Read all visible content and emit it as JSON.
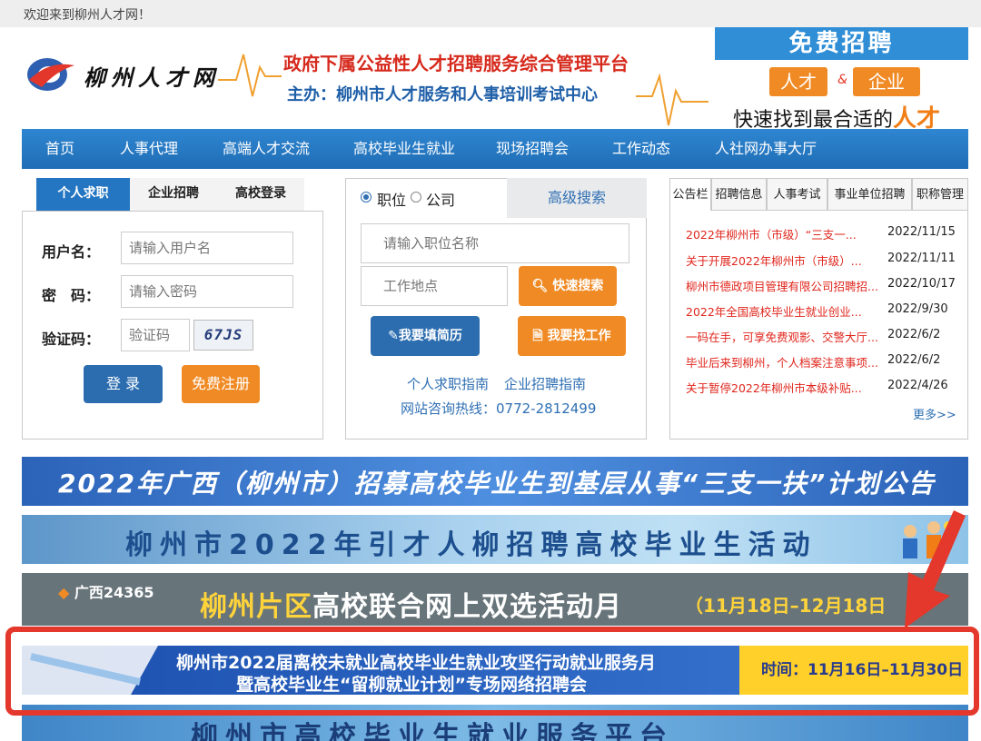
{
  "topbar": {
    "welcome": "欢迎来到柳州人才网！"
  },
  "header": {
    "logo_text": "柳州人才网",
    "slogan_line1": "政府下属公益性人才招聘服务综合管理平台",
    "slogan_line2": "主办：柳州市人才服务和人事培训考试中心",
    "ad_title": "免费招聘",
    "ad_tag1": "人才",
    "ad_amp": "&",
    "ad_tag2": "企业",
    "ad_line": "快速找到最合适的",
    "ad_line_highlight": "人才"
  },
  "nav": {
    "items": [
      "首页",
      "人事代理",
      "高端人才交流",
      "高校毕业生就业",
      "现场招聘会",
      "工作动态",
      "人社网办事大厅"
    ]
  },
  "login": {
    "tabs": [
      "个人求职",
      "企业招聘",
      "高校登录"
    ],
    "username_label": "用户名：",
    "username_placeholder": "请输入用户名",
    "password_label": "密　码：",
    "password_placeholder": "请输入密码",
    "captcha_label": "验证码：",
    "captcha_placeholder": "验证码",
    "captcha_image_text": "67JS",
    "login_button": "登 录",
    "register_button": "免费注册"
  },
  "search": {
    "radio_job": "职位",
    "radio_company": "公司",
    "advanced_tab": "高级搜索",
    "job_placeholder": "请输入职位名称",
    "location_placeholder": "工作地点",
    "quick_search_button": "快速搜索",
    "fill_resume_button": "我要填简历",
    "find_job_button": "我要找工作",
    "guide_personal": "个人求职指南",
    "guide_company": "企业招聘指南",
    "hotline": "网站咨询热线：0772-2812499"
  },
  "notices": {
    "tabs": [
      "公告栏",
      "招聘信息",
      "人事考试",
      "事业单位招聘",
      "职称管理"
    ],
    "items": [
      {
        "title": "2022年柳州市（市级）“三支一...",
        "date": "2022/11/15"
      },
      {
        "title": "关于开展2022年柳州市（市级）...",
        "date": "2022/11/11"
      },
      {
        "title": "柳州市德政项目管理有限公司招聘招...",
        "date": "2022/10/17"
      },
      {
        "title": "2022年全国高校毕业生就业创业...",
        "date": "2022/9/30"
      },
      {
        "title": "一码在手，可享免费观影、交警大厅...",
        "date": "2022/6/2"
      },
      {
        "title": "毕业后来到柳州，个人档案注意事项...",
        "date": "2022/6/2"
      },
      {
        "title": "关于暂停2022年柳州市本级补贴...",
        "date": "2022/4/26"
      }
    ],
    "more": "更多>>"
  },
  "banners": {
    "b1": "2022年广西（柳州市）招募高校毕业生到基层从事“三支一扶”计划公告",
    "b2": "柳州市2022年引才人柳招聘高校毕业生活动",
    "b3_logo": "广西24365",
    "b3_main_prefix": "柳州片区",
    "b3_main_rest": "高校联合网上双选活动月",
    "b3_date": "（11月18日–12月18日",
    "b4_line1": "柳州市2022届离校未就业高校毕业生就业攻坚行动就业服务月",
    "b4_line2": "暨高校毕业生“留柳就业计划”专场网络招聘会",
    "b4_time": "时间：11月16日–11月30日",
    "b5": "柳州市高校毕业生就业服务平台"
  },
  "colors": {
    "nav_blue": "#2476c2",
    "alert_red": "#e0251c",
    "button_blue": "#2f6fb3",
    "button_orange": "#f08a24",
    "highlight_frame": "#e3382b"
  }
}
